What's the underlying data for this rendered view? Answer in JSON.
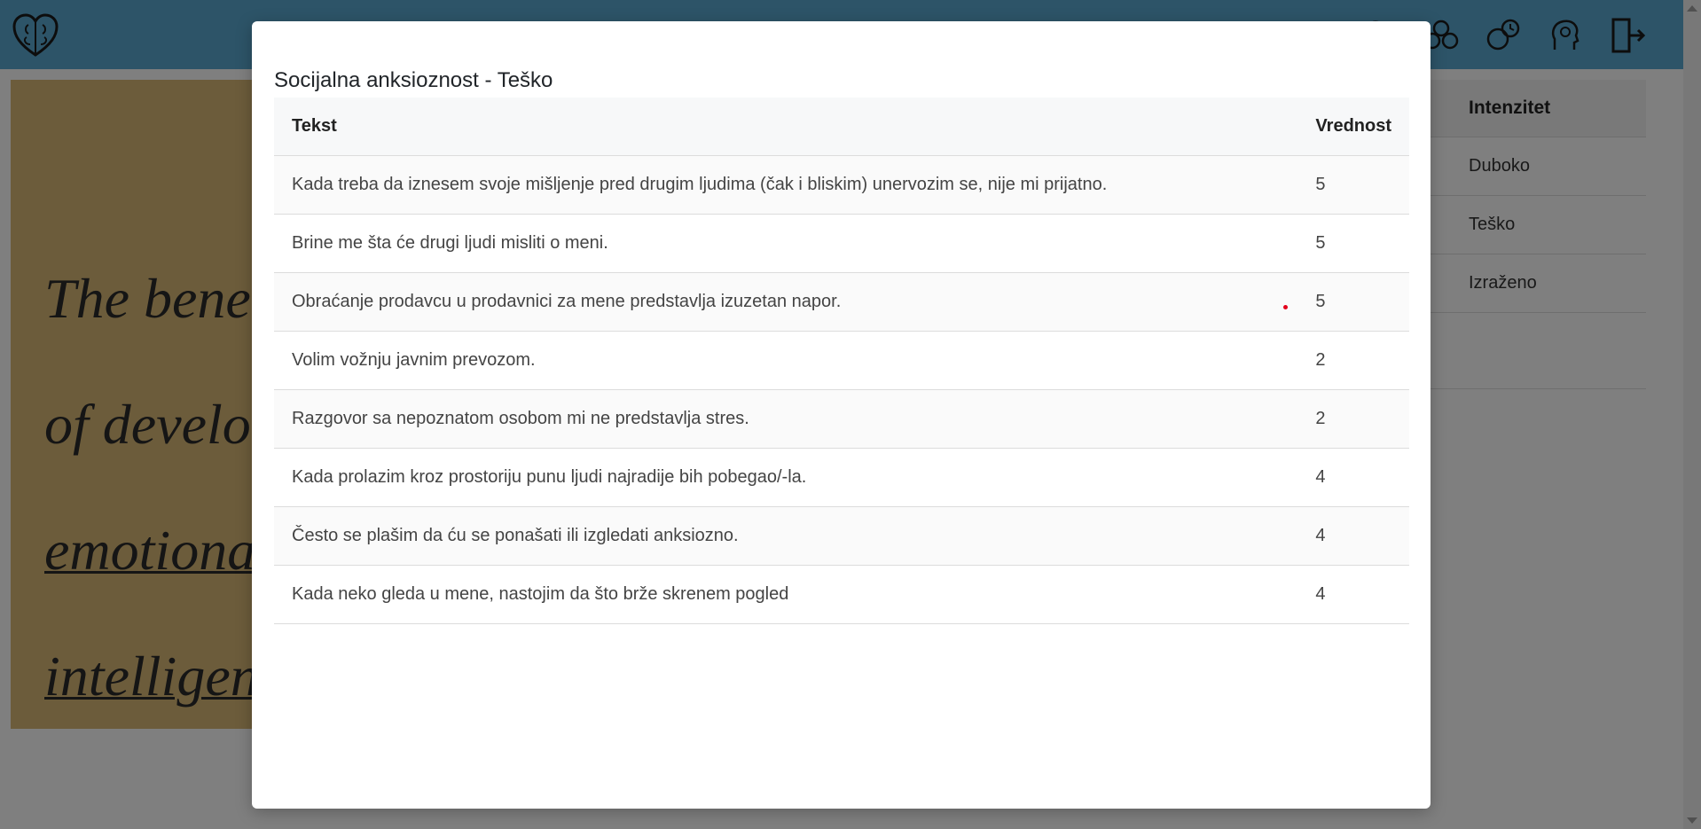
{
  "hero": {
    "line1": "The bene",
    "line2": "of develo",
    "line3": "emotiona",
    "line4": "intelligen"
  },
  "background_table": {
    "header": "Intenzitet",
    "rows": [
      "Duboko",
      "Teško",
      "Izraženo"
    ]
  },
  "nav": {
    "icons": [
      "search-icon",
      "group-icon",
      "mood-history-icon",
      "mind-icon",
      "logout-icon"
    ]
  },
  "modal": {
    "title": "Socijalna anksioznost - Teško",
    "columns": {
      "text": "Tekst",
      "value": "Vrednost"
    },
    "rows": [
      {
        "text": "Kada treba da iznesem svoje mišljenje pred drugim ljudima (čak i bliskim) unervozim se, nije mi prijatno.",
        "value": "5"
      },
      {
        "text": "Brine me šta će drugi ljudi misliti o meni.",
        "value": "5"
      },
      {
        "text": "Obraćanje prodavcu u prodavnici za mene predstavlja izuzetan napor.",
        "value": "5"
      },
      {
        "text": "Volim vožnju javnim prevozom.",
        "value": "2"
      },
      {
        "text": "Razgovor sa nepoznatom osobom mi ne predstavlja stres.",
        "value": "2"
      },
      {
        "text": "Kada prolazim kroz prostoriju punu ljudi najradije bih pobegao/-la.",
        "value": "4"
      },
      {
        "text": "Često se plašim da ću se ponašati ili izgledati anksiozno.",
        "value": "4"
      },
      {
        "text": "Kada neko gleda u mene, nastojim da što brže skrenem pogled",
        "value": "4"
      }
    ]
  },
  "colors": {
    "topbar": "#5aa9d0",
    "hero_bg": "#d9b877",
    "overlay": "rgba(0,0,0,0.5)"
  }
}
